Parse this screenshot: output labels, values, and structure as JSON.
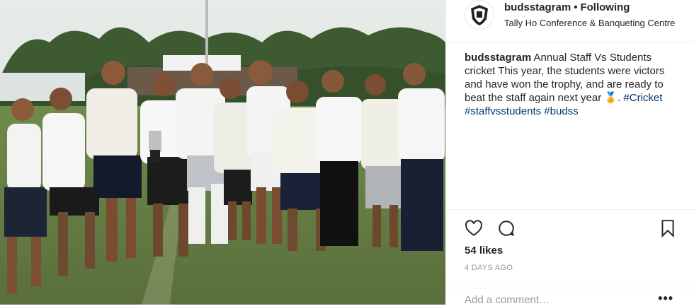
{
  "photo": {
    "alt_icon": "group-photo"
  },
  "header": {
    "username": "budsstagram",
    "separator": "•",
    "follow_label": "Following",
    "location": "Tally Ho Conference & Banqueting Centre"
  },
  "caption": {
    "username": "budsstagram",
    "text": "Annual Staff Vs Students cricket This year, the students were victors and have won the trophy, and are ready to beat the staff again next year",
    "emoji": "🏅",
    "after_emoji": ".",
    "hashtags": [
      "#Cricket",
      "#staffvsstudents",
      "#budss"
    ]
  },
  "actions": {
    "like_icon": "heart-icon",
    "comment_icon": "comment-bubble-icon",
    "save_icon": "bookmark-icon"
  },
  "likes": "54 likes",
  "time": "4 DAYS AGO",
  "comment": {
    "placeholder": "Add a comment…",
    "more": "•••"
  },
  "colors": {
    "link": "#003569",
    "text": "#262626",
    "muted": "#999999",
    "border": "#efefef"
  }
}
